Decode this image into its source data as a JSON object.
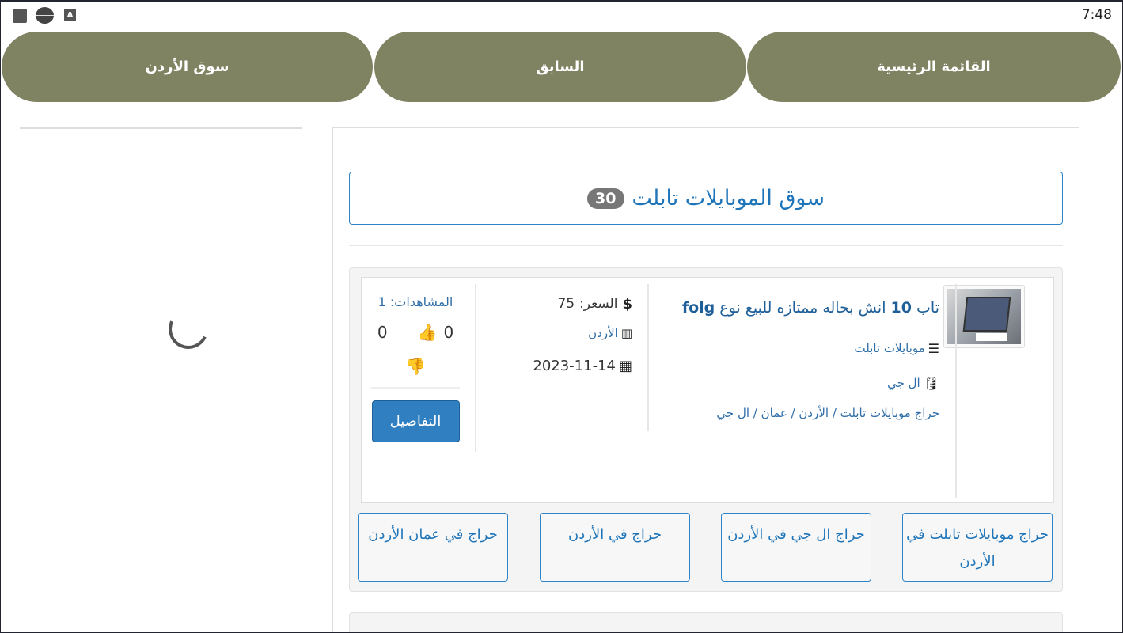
{
  "statusbar": {
    "time": "7:48"
  },
  "nav": {
    "home": "القائمة الرئيسية",
    "previous": "السابق",
    "market": "سوق الأردن"
  },
  "section": {
    "title": "سوق الموبايلات تابلت",
    "count": "30"
  },
  "listing": {
    "title_prefix": "تاب",
    "title_number": "10",
    "title_rest": "انش بحاله ممتازه للبيع نوع",
    "title_brand": "folg",
    "category": "موبايلات تابلت",
    "brand": "ال جي",
    "breadcrumb": "حراج موبايلات تابلت / الأردن / عمان / ال جي",
    "price_label": "السعر:",
    "price_value": "75",
    "location": "الأردن",
    "date": "2023-11-14",
    "views_label": "المشاهدات:",
    "views_value": "1",
    "likes": "0",
    "dislikes": "0",
    "details_label": "التفاصيل"
  },
  "tags": [
    "حراج موبايلات تابلت في الأردن",
    "حراج ال جي في الأردن",
    "حراج في الأردن",
    "حراج في عمان الأردن"
  ]
}
